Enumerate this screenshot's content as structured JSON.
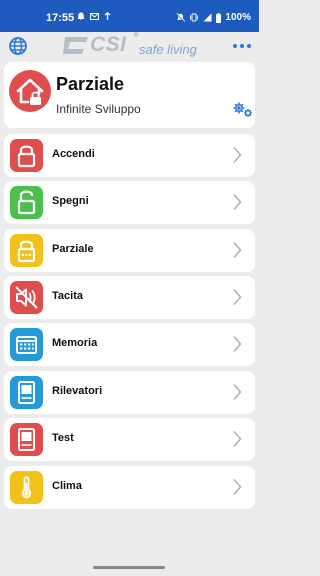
{
  "status_bar": {
    "time": "17:55",
    "battery": "100%",
    "left_icons": [
      "alarm-icon",
      "mail-icon",
      "sync-icon"
    ],
    "right_icons": [
      "mute-icon",
      "vibrate-icon",
      "signal-icon",
      "battery-icon"
    ]
  },
  "app_bar": {
    "logo_text": "CSI",
    "logo_reg": "®",
    "logo_tagline": "safe living"
  },
  "status_card": {
    "title": "Parziale",
    "subtitle": "Infinite Sviluppo"
  },
  "menu": [
    {
      "label": "Accendi",
      "icon": "lock-closed-icon",
      "color": "#e04d4d"
    },
    {
      "label": "Spegni",
      "icon": "lock-open-icon",
      "color": "#4cbf4c"
    },
    {
      "label": "Parziale",
      "icon": "lock-partial-icon",
      "color": "#f2c21b"
    },
    {
      "label": "Tacita",
      "icon": "speaker-mute-icon",
      "color": "#e04d4d"
    },
    {
      "label": "Memoria",
      "icon": "calendar-icon",
      "color": "#2799d8"
    },
    {
      "label": "Rilevatori",
      "icon": "detector-icon",
      "color": "#2799d8"
    },
    {
      "label": "Test",
      "icon": "test-icon",
      "color": "#e04d4d"
    },
    {
      "label": "Clima",
      "icon": "thermometer-icon",
      "color": "#f2c21b"
    }
  ],
  "colors": {
    "status_bar_bg": "#1e5bbf",
    "accent_blue": "#2d7ad6",
    "background": "#ececec"
  }
}
